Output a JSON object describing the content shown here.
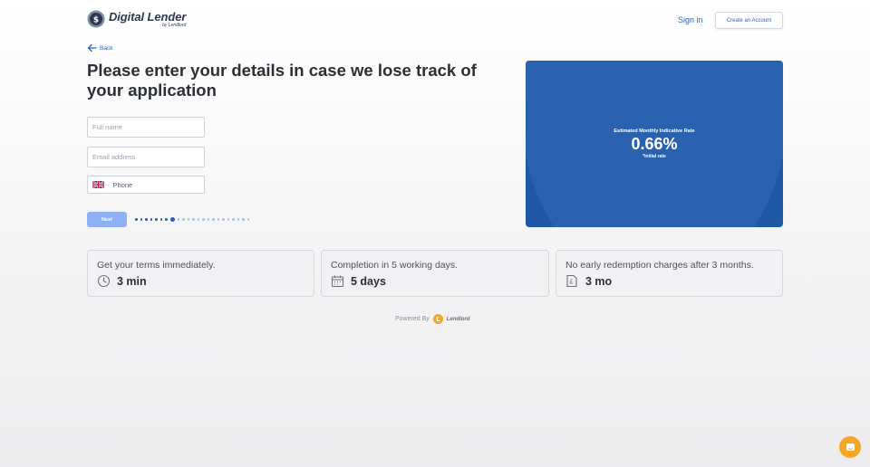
{
  "header": {
    "brand_name": "Digital Lender",
    "brand_sub": "by Lendlord",
    "signin_label": "Sign in",
    "create_account_label": "Create an Account"
  },
  "nav": {
    "back_label": "Back"
  },
  "main": {
    "heading": "Please enter your details in case we lose track of your application",
    "form": {
      "full_name_placeholder": "Full name",
      "email_placeholder": "Email address",
      "phone_placeholder": "Phone",
      "phone_dash": "-",
      "next_label": "Next"
    },
    "progress": {
      "current_step": 8,
      "total_steps": 23
    }
  },
  "rate_card": {
    "label": "Estimated Monthly Indicative Rate",
    "value": "0.66%",
    "note": "*initial rate"
  },
  "features": [
    {
      "title": "Get your terms immediately.",
      "value": "3 min",
      "icon": "clock-icon"
    },
    {
      "title": "Completion in 5 working days.",
      "value": "5 days",
      "icon": "calendar-icon"
    },
    {
      "title": "No early redemption charges after 3 months.",
      "value": "3 mo",
      "icon": "pound-document-icon"
    }
  ],
  "footer": {
    "powered_label": "Powered By",
    "powered_brand": "Lendlord"
  },
  "colors": {
    "accent": "#2a62b8",
    "card": "#1f58a3",
    "next_button": "#8db1f4",
    "chat": "#f5a623"
  }
}
